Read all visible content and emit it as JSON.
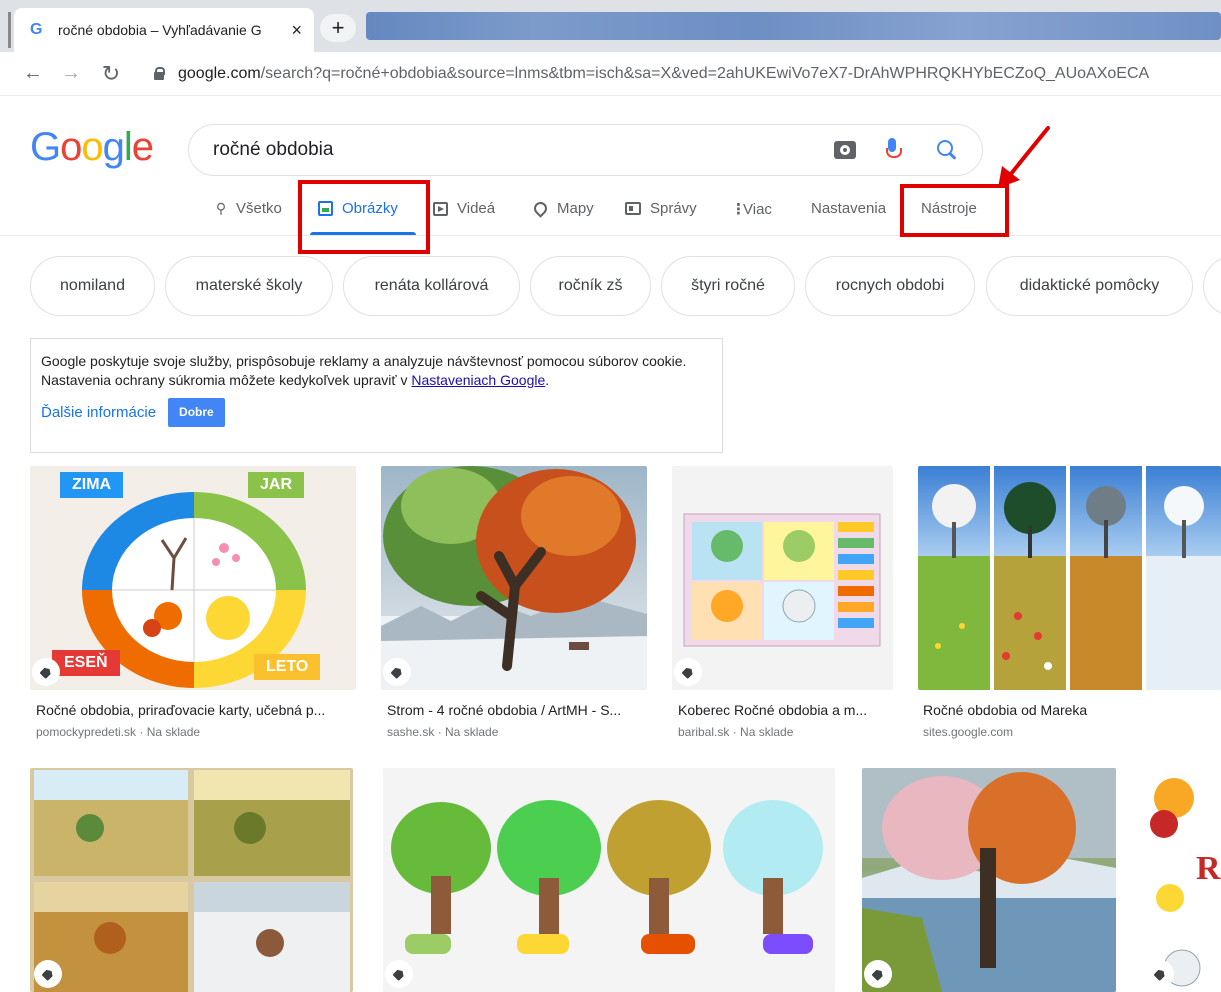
{
  "browser": {
    "tab_title": "ročné obdobia – Vyhľadávanie G",
    "tab_close": "×",
    "new_tab": "+",
    "url_host": "google.com",
    "url_rest": "/search?q=ročné+obdobia&source=lnms&tbm=isch&sa=X&ved=2ahUKEwiVo7eX7-DrAhWPHRQKHYbECZoQ_AUoAXoECA"
  },
  "logo": [
    "G",
    "o",
    "o",
    "g",
    "l",
    "e"
  ],
  "search": {
    "query": "ročné obdobia"
  },
  "nav": {
    "all": "Všetko",
    "images": "Obrázky",
    "videos": "Videá",
    "maps": "Mapy",
    "news": "Správy",
    "more": "Viac",
    "settings": "Nastavenia",
    "tools": "Nástroje"
  },
  "chips": [
    "nomiland",
    "materské školy",
    "renáta kollárová",
    "ročník zš",
    "štyri ročné",
    "rocnych obdobi",
    "didaktické pomôcky"
  ],
  "cookie": {
    "text_1": "Google poskytuje svoje služby, prispôsobuje reklamy a analyzuje návštevnosť pomocou súborov cookie. Nastavenia ochrany súkromia môžete kedykoľvek upraviť v ",
    "link": "Nastaveniach Google",
    "text_2": ".",
    "more": "Ďalšie informácie",
    "ok": "Dobre"
  },
  "images_row1": [
    {
      "caption": "Ročné obdobia, priraďovacie karty, učebná p...",
      "source": "pomockypredeti.sk · Na sklade"
    },
    {
      "caption": "Strom - 4 ročné obdobia / ArtMH - S...",
      "source": "sashe.sk · Na sklade"
    },
    {
      "caption": "Koberec Ročné obdobia a m...",
      "source": "baribal.sk · Na sklade"
    },
    {
      "caption": "Ročné obdobia od Mareka",
      "source": "sites.google.com"
    }
  ],
  "thumb1_cards": {
    "winter": "ZIMA",
    "spring": "JAR",
    "autumn": "ESEŇ",
    "summer": "LETO"
  },
  "thumb8_letter": "R",
  "colors": {
    "accent": "#1a73e8",
    "highlight": "#e00000"
  }
}
